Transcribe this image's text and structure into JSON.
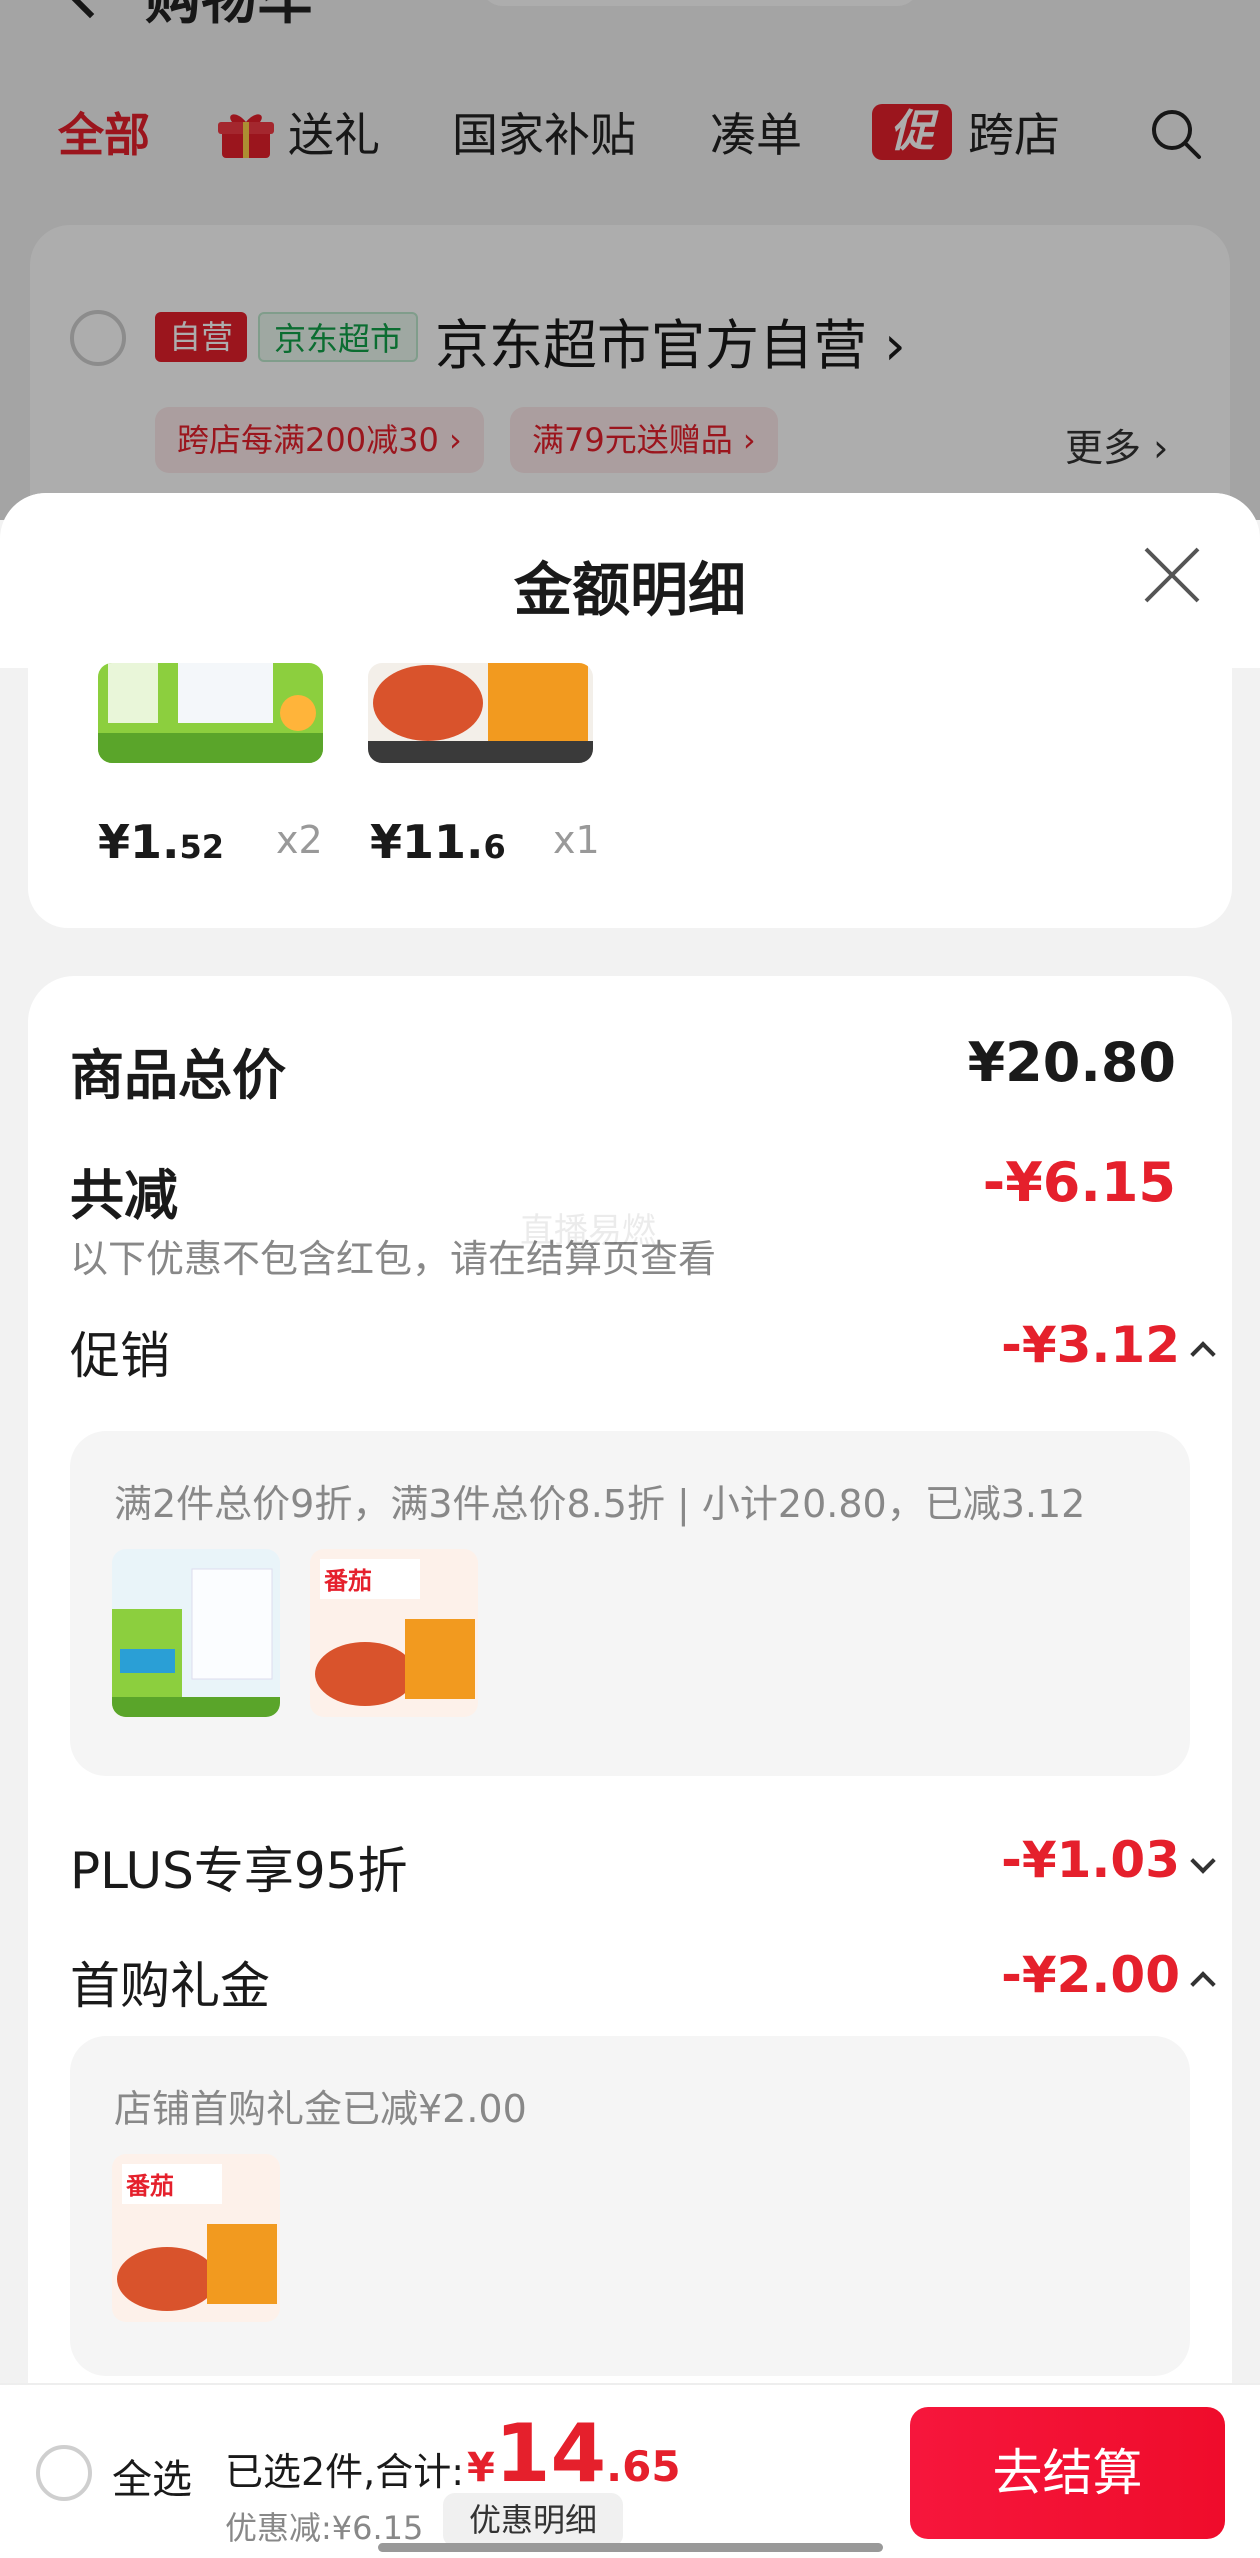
{
  "topbar": {
    "title": "购物车",
    "more": "···"
  },
  "tabs": [
    {
      "label": "全部",
      "active": true
    },
    {
      "label": "送礼",
      "icon": "gift-icon"
    },
    {
      "label": "国家补贴"
    },
    {
      "label": "凑单"
    },
    {
      "label": "跨店",
      "badge": "促"
    }
  ],
  "store": {
    "tag_self": "自营",
    "tag_market": "京东超市",
    "name": "京东超市官方自营 ›",
    "promo1": "跨店每满200减30 ›",
    "promo2": "满79元送赠品 ›",
    "more": "更多 ›"
  },
  "sheet": {
    "title": "金额明细",
    "items": [
      {
        "price_int": "¥1.",
        "price_dec": "52",
        "qty": "x2",
        "product": "salt-product"
      },
      {
        "price_int": "¥11.",
        "price_dec": "6",
        "qty": "x1",
        "product": "tomato-noodle-product"
      }
    ],
    "total_label": "商品总价",
    "total_value": "¥20.80",
    "reduce_label": "共减",
    "reduce_value": "-¥6.15",
    "reduce_note": "以下优惠不包含红包，请在结算页查看",
    "promo_label": "促销",
    "promo_value": "-¥3.12",
    "promo_detail": "满2件总价9折，满3件总价8.5折 | 小计20.80，已减3.12",
    "plus_label": "PLUS专享95折",
    "plus_value": "-¥1.03",
    "first_label": "首购礼金",
    "first_value": "-¥2.00",
    "first_detail": "店铺首购礼金已减¥2.00",
    "watermark": "直播易燃"
  },
  "bottom": {
    "select_all": "全选",
    "selected": "已选2件,合计:",
    "currency": "¥",
    "total_int": "14",
    "total_dec": ".65",
    "discount": "优惠减:¥6.15",
    "discount_detail": "优惠明细",
    "checkout": "去结算"
  },
  "colors": {
    "accent": "#e5202c",
    "green": "#11a149"
  }
}
